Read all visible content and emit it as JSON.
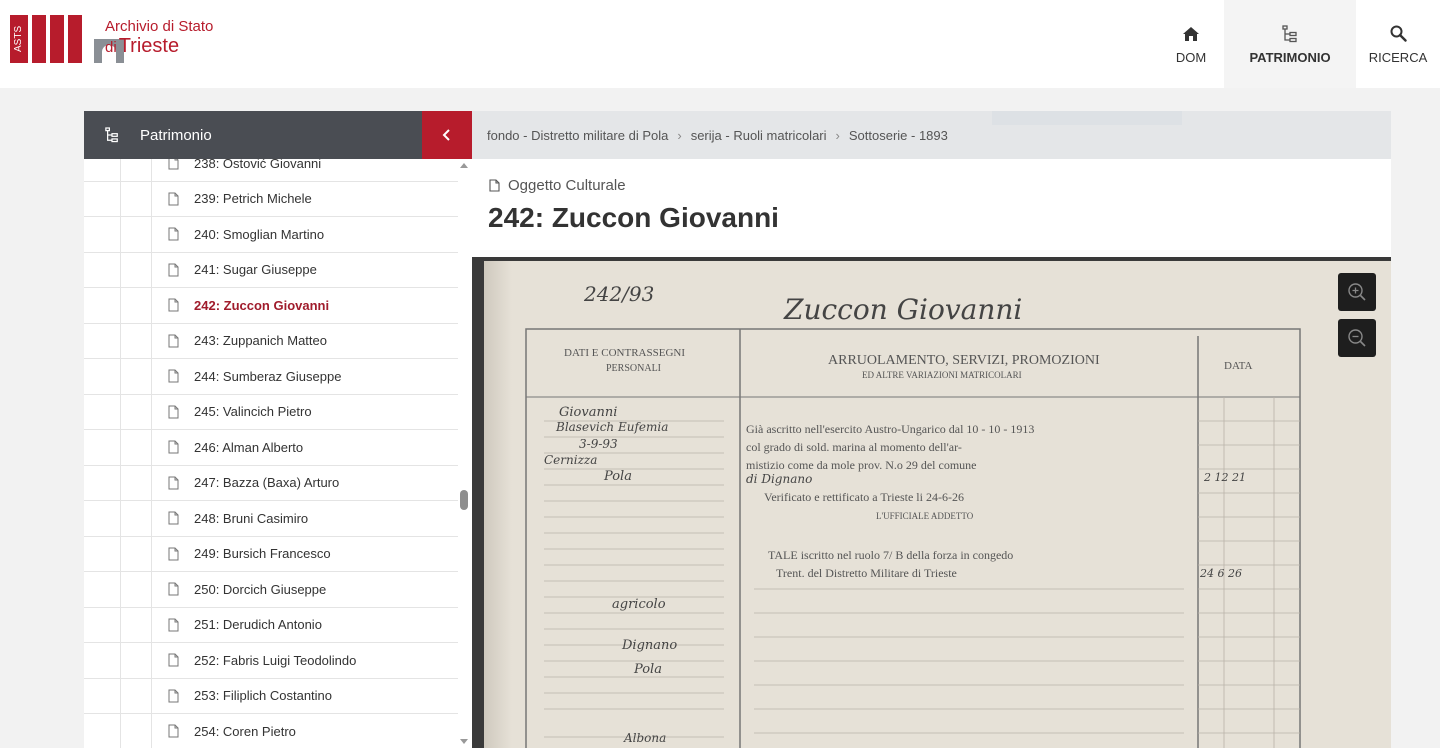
{
  "header": {
    "logo": {
      "badge": "ASTS",
      "line1": "Archivio di Stato",
      "line2_prefix": "di",
      "line2": "Trieste"
    },
    "nav": [
      {
        "label": "DOM",
        "icon": "home-icon",
        "active": false
      },
      {
        "label": "PATRIMONIO",
        "icon": "tree-icon",
        "active": true
      },
      {
        "label": "RICERCA",
        "icon": "search-icon",
        "active": false
      }
    ]
  },
  "sidebar": {
    "title": "Patrimonio",
    "items": [
      {
        "label": "238: Ostović Giovanni",
        "active": false
      },
      {
        "label": "239: Petrich Michele",
        "active": false
      },
      {
        "label": "240: Smoglian Martino",
        "active": false
      },
      {
        "label": "241: Sugar Giuseppe",
        "active": false
      },
      {
        "label": "242: Zuccon Giovanni",
        "active": true
      },
      {
        "label": "243: Zuppanich Matteo",
        "active": false
      },
      {
        "label": "244: Sumberaz Giuseppe",
        "active": false
      },
      {
        "label": "245: Valincich Pietro",
        "active": false
      },
      {
        "label": "246: Alman Alberto",
        "active": false
      },
      {
        "label": "247: Bazza (Baxa) Arturo",
        "active": false
      },
      {
        "label": "248: Bruni Casimiro",
        "active": false
      },
      {
        "label": "249: Bursich Francesco",
        "active": false
      },
      {
        "label": "250: Dorcich Giuseppe",
        "active": false
      },
      {
        "label": "251: Derudich Antonio",
        "active": false
      },
      {
        "label": "252: Fabris Luigi Teodolindo",
        "active": false
      },
      {
        "label": "253: Filiplich Costantino",
        "active": false
      },
      {
        "label": "254: Coren Pietro",
        "active": false
      }
    ]
  },
  "breadcrumb": {
    "items": [
      "fondo - Distretto militare di Pola",
      "serija - Ruoli matricolari",
      "Sottoserie - 1893"
    ],
    "separator": "›"
  },
  "record": {
    "kind": "Oggetto Culturale",
    "title": "242: Zuccon Giovanni"
  },
  "document": {
    "number": "242/93",
    "name": "Zuccon Giovanni",
    "col1_header_a": "DATI E CONTRASSEGNI",
    "col1_header_b": "PERSONALI",
    "col2_header_a": "ARRUOLAMENTO, SERVIZI, PROMOZIONI",
    "col2_header_b": "ED ALTRE VARIAZIONI MATRICOLARI",
    "col3_header": "DATA",
    "father": "Giovanni",
    "mother": "Blasevich Eufemia",
    "birth_date": "3-9-93",
    "birth_place": "Cernizza",
    "district": "Pola",
    "profession": "agricolo",
    "municipality": "Dignano",
    "district2": "Pola",
    "residence": "Albona",
    "service_line1": "Già ascritto nell'esercito Austro-Ungarico dal 10 - 10 - 1913",
    "service_line2": "col grado di sold. marina al momento dell'ar-",
    "service_line3": "mistizio come da mole prov. N.o 29 del comune",
    "service_line4": "di Dignano",
    "verified": "Verificato e rettificato a Trieste li 24-6-26",
    "officer": "L'UFFICIALE ADDETTO",
    "tale_line1": "TALE iscritto nel ruolo 7/ B della forza in congedo",
    "tale_line2": "Trent.          del Distretto Militare di Trieste",
    "date_1": "2  12  21",
    "date_2": "24  6  26"
  },
  "viewer": {
    "zoom_in": "zoom-in-icon",
    "zoom_out": "zoom-out-icon"
  },
  "colors": {
    "brand": "#b71c2c",
    "active_item": "#a01c2c",
    "sidebar_header": "#4a4d53"
  }
}
